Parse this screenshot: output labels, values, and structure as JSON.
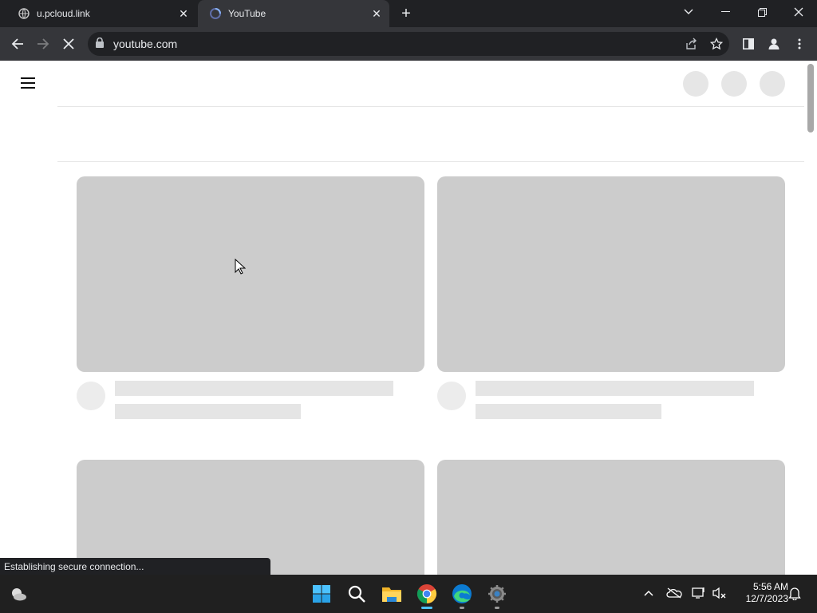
{
  "browser": {
    "tabs": [
      {
        "title": "u.pcloud.link",
        "favicon": "globe-icon",
        "active": false
      },
      {
        "title": "YouTube",
        "favicon": "youtube-loading-icon",
        "active": true
      }
    ],
    "address": "youtube.com",
    "window_controls": [
      "tab-search-icon",
      "minimize-icon",
      "restore-icon",
      "close-icon"
    ],
    "toolbar_icons": [
      "back-icon",
      "forward-icon",
      "stop-loading-icon",
      "share-icon",
      "bookmark-star-icon",
      "side-panel-icon",
      "profile-icon",
      "more-menu-icon"
    ]
  },
  "page": {
    "state": "loading-skeleton",
    "placeholder_color": "#cccccc"
  },
  "status_bar": {
    "text": "Establishing secure connection..."
  },
  "taskbar": {
    "apps": [
      "weather-icon",
      "start-icon",
      "search-icon",
      "file-explorer-icon",
      "chrome-icon",
      "edge-icon",
      "settings-icon"
    ],
    "tray_icons": [
      "show-hidden-icons-chevron",
      "onedrive-icon",
      "network-icon",
      "volume-muted-icon",
      "notifications-icon"
    ],
    "time": "5:56 AM",
    "date": "12/7/2023"
  },
  "colors": {
    "accent": "#4cc2ff",
    "browser_bg": "#202124",
    "toolbar_bg": "#35363a",
    "taskbar_bg": "#202020"
  }
}
